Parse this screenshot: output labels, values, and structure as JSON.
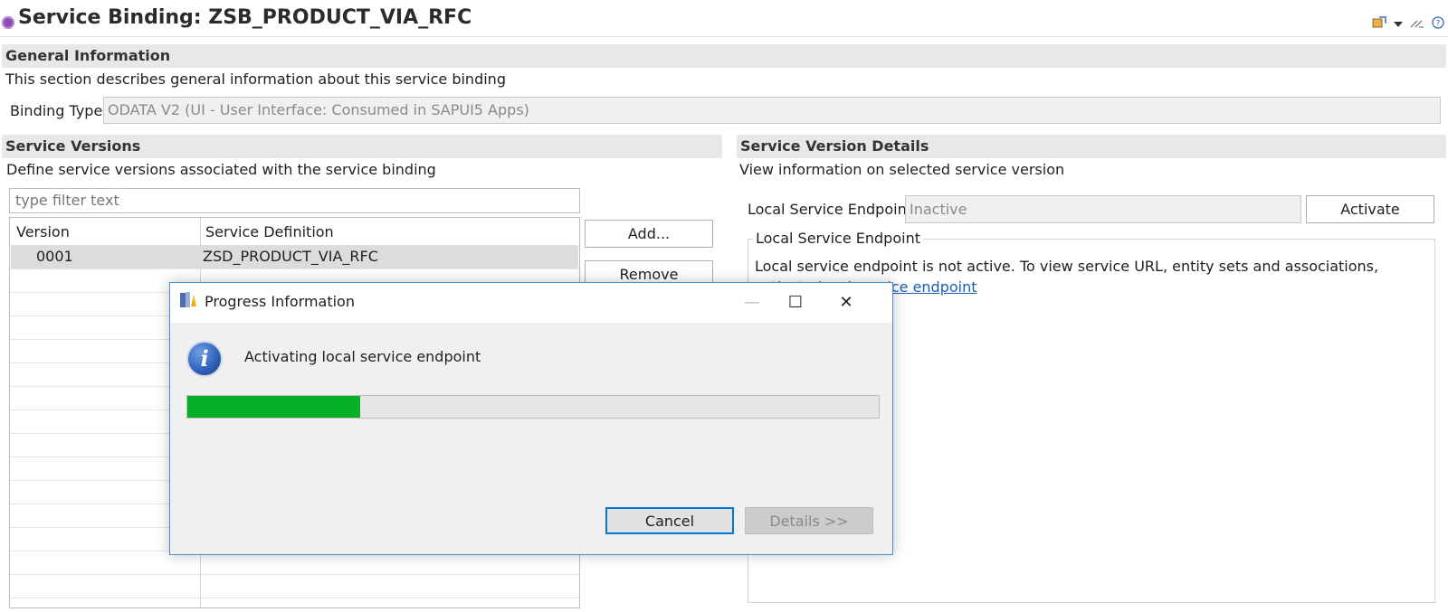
{
  "header": {
    "title": "Service Binding: ZSB_PRODUCT_VIA_RFC",
    "icons": [
      "service-binding-icon",
      "publish-icon",
      "dropdown-icon",
      "collapse-icon",
      "help-icon"
    ]
  },
  "general": {
    "heading": "General Information",
    "description": "This section describes general information about this service binding",
    "binding_type_label": "Binding Type:",
    "binding_type_value": "ODATA V2 (UI - User Interface: Consumed in SAPUI5 Apps)"
  },
  "versions": {
    "heading": "Service Versions",
    "description": "Define service versions associated with the service binding",
    "filter_placeholder": "type filter text",
    "columns": [
      "Version",
      "Service Definition"
    ],
    "rows": [
      {
        "version": "0001",
        "definition": "ZSD_PRODUCT_VIA_RFC"
      }
    ],
    "add_label": "Add...",
    "remove_label": "Remove"
  },
  "details": {
    "heading": "Service Version Details",
    "description": "View information on selected service version",
    "endpoint_label": "Local Service Endpoint:",
    "endpoint_value": "Inactive",
    "activate_label": "Activate",
    "group_title": "Local Service Endpoint",
    "message_text": "Local service endpoint is not active. To view service URL, entity sets and associations,",
    "message_link": "activate local service endpoint"
  },
  "dialog": {
    "title": "Progress Information",
    "message": "Activating local service endpoint",
    "progress": 0.25,
    "cancel_label": "Cancel",
    "details_label": "Details >>",
    "minimize_glyph": "—",
    "maximize_glyph": "☐",
    "close_glyph": "✕",
    "info_glyph": "i"
  },
  "colors": {
    "progress_fill": "#06b025",
    "link": "#1a5fb4",
    "section_bar": "#e8e8e8"
  }
}
